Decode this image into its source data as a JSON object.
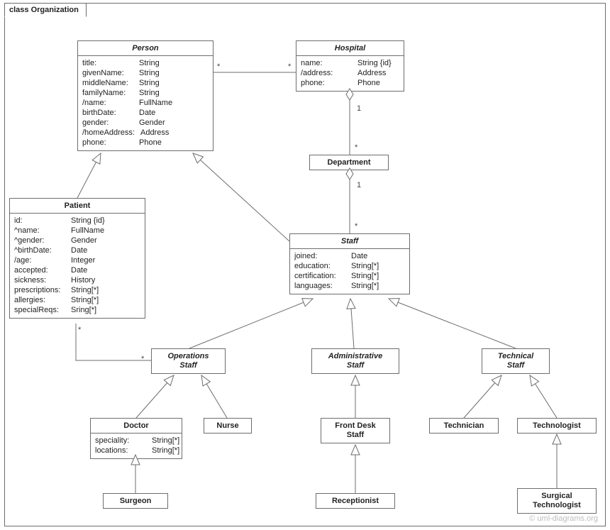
{
  "package": {
    "label": "class Organization"
  },
  "classes": {
    "person": {
      "name": "Person",
      "attrs": [
        {
          "n": "title:",
          "t": "String"
        },
        {
          "n": "givenName:",
          "t": "String"
        },
        {
          "n": "middleName:",
          "t": "String"
        },
        {
          "n": "familyName:",
          "t": "String"
        },
        {
          "n": "/name:",
          "t": "FullName"
        },
        {
          "n": "birthDate:",
          "t": "Date"
        },
        {
          "n": "gender:",
          "t": "Gender"
        },
        {
          "n": "/homeAddress:",
          "t": "Address"
        },
        {
          "n": "phone:",
          "t": "Phone"
        }
      ]
    },
    "hospital": {
      "name": "Hospital",
      "attrs": [
        {
          "n": "name:",
          "t": "String {id}"
        },
        {
          "n": "/address:",
          "t": "Address"
        },
        {
          "n": "phone:",
          "t": "Phone"
        }
      ]
    },
    "department": {
      "name": "Department"
    },
    "patient": {
      "name": "Patient",
      "attrs": [
        {
          "n": "id:",
          "t": "String {id}"
        },
        {
          "n": "^name:",
          "t": "FullName"
        },
        {
          "n": "^gender:",
          "t": "Gender"
        },
        {
          "n": "^birthDate:",
          "t": "Date"
        },
        {
          "n": "/age:",
          "t": "Integer"
        },
        {
          "n": "accepted:",
          "t": "Date"
        },
        {
          "n": "sickness:",
          "t": "History"
        },
        {
          "n": "prescriptions:",
          "t": "String[*]"
        },
        {
          "n": "allergies:",
          "t": "String[*]"
        },
        {
          "n": "specialReqs:",
          "t": "Sring[*]"
        }
      ]
    },
    "staff": {
      "name": "Staff",
      "attrs": [
        {
          "n": "joined:",
          "t": "Date"
        },
        {
          "n": "education:",
          "t": "String[*]"
        },
        {
          "n": "certification:",
          "t": "String[*]"
        },
        {
          "n": "languages:",
          "t": "String[*]"
        }
      ]
    },
    "opsStaff": {
      "name1": "Operations",
      "name2": "Staff"
    },
    "adminStaff": {
      "name1": "Administrative",
      "name2": "Staff"
    },
    "techStaff": {
      "name1": "Technical",
      "name2": "Staff"
    },
    "doctor": {
      "name": "Doctor",
      "attrs": [
        {
          "n": "speciality:",
          "t": "String[*]"
        },
        {
          "n": "locations:",
          "t": "String[*]"
        }
      ]
    },
    "nurse": {
      "name": "Nurse"
    },
    "frontDesk": {
      "name1": "Front Desk",
      "name2": "Staff"
    },
    "technician": {
      "name": "Technician"
    },
    "technologist": {
      "name": "Technologist"
    },
    "surgeon": {
      "name": "Surgeon"
    },
    "receptionist": {
      "name": "Receptionist"
    },
    "surgTech": {
      "name1": "Surgical",
      "name2": "Technologist"
    }
  },
  "mult": {
    "person_hosp_l": "*",
    "person_hosp_r": "*",
    "hosp_dept_top": "1",
    "hosp_dept_bot": "*",
    "dept_staff_top": "1",
    "dept_staff_bot": "*",
    "patient_ops_l": "*",
    "patient_ops_r": "*"
  },
  "watermark": "© uml-diagrams.org"
}
